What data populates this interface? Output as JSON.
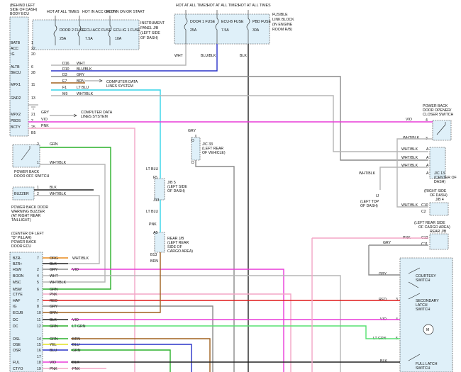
{
  "colors": {
    "WHT": "#b5b5b5",
    "BLU_BLK": "#2a33c9",
    "GRY": "#8a8a8a",
    "BRN": "#a0601e",
    "LT_BLU": "#34d3e8",
    "VIO": "#e83cd8",
    "PNK": "#f3a6c6",
    "GRN": "#2ab02a",
    "ORG": "#e88a1c",
    "YEL": "#e0e020",
    "BLK": "#222222",
    "RED": "#e01a1a",
    "LT_GRN": "#56e070",
    "BOX": "#dff0f9"
  },
  "body_ecu": {
    "header": [
      "(BEHIND LEFT",
      "SIDE OF DASH)",
      "BODY ECU"
    ],
    "pins": [
      "BATB",
      "ACC",
      "IG",
      "ALTB",
      "BECU",
      "MPX1",
      "GND2",
      "MPX2",
      "PBDS",
      "BCTY"
    ],
    "pin_numbers": [
      "1",
      "22",
      "20",
      "6",
      "28",
      "11",
      "13",
      "21",
      "2",
      "25"
    ]
  },
  "ip_jb": {
    "header": [
      "HOT AT ALL TIMES",
      "HOT IN ACC OR ON",
      "HOT IN ON OR START"
    ],
    "fuses": [
      {
        "name": "DOOR 2 FUSE",
        "amps": "25A"
      },
      {
        "name": "ECU-ACC FUSE",
        "amps": "7.5A"
      },
      {
        "name": "ECU-IG 1 FUSE",
        "amps": "10A"
      }
    ],
    "label": [
      "INSTRUMENT",
      "PANEL J/B",
      "(LEFT SIDE",
      "OF DASH)"
    ]
  },
  "fusible_block": {
    "header": [
      "HOT AT ALL TIMES",
      "HOT AT ALL TIMES",
      "HOT AT ALL TIMES"
    ],
    "fuses": [
      {
        "name": "DOOR 1 FUSE",
        "amps": "25A"
      },
      {
        "name": "ECU-B FUSE",
        "amps": "7.5A"
      },
      {
        "name": "PBD FUSE",
        "amps": "30A"
      }
    ],
    "label": [
      "FUSIBLE",
      "LINK BLOCK",
      "(IN ENGINE",
      "ROOM R/B)"
    ],
    "wires": [
      "WHT",
      "BLU/BLK",
      "BLK"
    ]
  },
  "connector_rows": [
    {
      "pin": "D16",
      "wire": "WHT"
    },
    {
      "pin": "D10",
      "wire": "BLU/BLK"
    },
    {
      "pin": "D3",
      "wire": "GRY"
    },
    {
      "pin": "E7",
      "wire": "BRN"
    },
    {
      "pin": "F1",
      "wire": "LT BLU"
    },
    {
      "pin": "M9",
      "wire": "WHT/BLK"
    }
  ],
  "computer_data_1": [
    "COMPUTER DATA",
    "LINES SYSTEM"
  ],
  "computer_data_2": [
    "COMPUTER DATA",
    "LINES SYSTEM"
  ],
  "mpx2_wire": "GRY",
  "pbds_wire": "VIO",
  "bcty_wire": "PNK",
  "bcty_pin": "B5",
  "jc33": [
    "J/C 33",
    "(LEFT REAR",
    "OF VEHICLE)"
  ],
  "jc33_wire": "GRY",
  "jc33_pins": [
    "D",
    "D"
  ],
  "jb5": [
    "J/B 5",
    "(LEFT SIDE",
    "OF DASH)"
  ],
  "jb5_pins": [
    "F5",
    "J13"
  ],
  "lt_blu_1": "LT BLU",
  "lt_blu_2": "LT BLU",
  "pnk_1": "PNK",
  "brn_1": "BRN",
  "rear_jb": [
    "REAR J/B",
    "(LEFT REAR",
    "SIDE OF",
    "CARGO AREA)"
  ],
  "rear_jb_pins": [
    "A5",
    "B13"
  ],
  "pbd_off_switch": {
    "pins": [
      "2",
      "1"
    ],
    "wires": [
      "GRN",
      "WHT/BLK"
    ],
    "label": [
      "POWER BACK",
      "DOOR OFF SWITCH"
    ]
  },
  "buzzer": {
    "name": "BUZZER",
    "pins": [
      "1",
      "2"
    ],
    "wires": [
      "BLK",
      "WHT/BLK"
    ],
    "label": [
      "POWER BACK DOOR",
      "WARNING BUZZER",
      "(AT RIGHT REAR",
      "TAILLIGHT)"
    ]
  },
  "pbd_ecu": {
    "label": [
      "(CENTER OF LEFT",
      "\"D\" PILLAR)",
      "POWER BACK",
      "DOOR ECU"
    ],
    "rows": [
      {
        "pin_name": "BZR-",
        "num": "7",
        "wire": "ORG",
        "ext": "WHT/BLK"
      },
      {
        "pin_name": "BZR+",
        "num": "",
        "wire": "BLK",
        "ext": ""
      },
      {
        "pin_name": "HSW",
        "num": "2",
        "wire": "GRY",
        "ext": "VIO"
      },
      {
        "pin_name": "BOON",
        "num": "4",
        "wire": "WHT",
        "ext": ""
      },
      {
        "pin_name": "MSC",
        "num": "5",
        "wire": "WHT/BLK",
        "ext": ""
      },
      {
        "pin_name": "MSW",
        "num": "6",
        "wire": "GRN",
        "ext": ""
      },
      {
        "pin_name": "CTYE",
        "num": "",
        "wire": "PNK",
        "ext": ""
      },
      {
        "pin_name": "HAF",
        "num": "7",
        "wire": "RED",
        "ext": ""
      },
      {
        "pin_name": "IG",
        "num": "8",
        "wire": "GRY",
        "ext": ""
      },
      {
        "pin_name": "ECUB",
        "num": "10",
        "wire": "BRN",
        "ext": ""
      },
      {
        "pin_name": "DC",
        "num": "11",
        "wire": "BLK",
        "ext": "VIO"
      },
      {
        "pin_name": "DC",
        "num": "12",
        "wire": "GRN",
        "ext": "LT GRN"
      },
      {
        "pin_name": "",
        "num": "",
        "wire": "",
        "ext": ""
      },
      {
        "pin_name": "OSL",
        "num": "14",
        "wire": "GRN",
        "ext": "BRN"
      },
      {
        "pin_name": "OSE",
        "num": "15",
        "wire": "YEL",
        "ext": "BLU"
      },
      {
        "pin_name": "OSR",
        "num": "16",
        "wire": "BLU",
        "ext": "GRN"
      },
      {
        "pin_name": "",
        "num": "17",
        "wire": "",
        "ext": ""
      },
      {
        "pin_name": "FUL",
        "num": "18",
        "wire": "VIO",
        "ext": "BLK"
      },
      {
        "pin_name": "CTYO",
        "num": "19",
        "wire": "PNK",
        "ext": "PNK"
      }
    ]
  },
  "closer_switch": {
    "label": [
      "POWER BACK",
      "DOOR OPENER/",
      "CLOSER SWITCH"
    ],
    "pins": [
      "4",
      "3"
    ],
    "wires": [
      "VIO",
      "WHT/BLK"
    ]
  },
  "jc13": {
    "label": [
      "J/C 13",
      "(CENTER OF",
      "DASH)"
    ],
    "pins": [
      "A",
      "A",
      "A",
      "A"
    ],
    "wires": [
      "WHT/BLK",
      "WHT/BLK",
      "WHT/BLK"
    ]
  },
  "left_top_dash": {
    "pin": "IJ",
    "wire": "WHT/BLK",
    "label": [
      "(LEFT TOP",
      "OF DASH)"
    ]
  },
  "jb4": {
    "label": [
      "(RIGHT SIDE",
      "OF DASH)",
      "J/B 4"
    ],
    "pins": [
      "C10",
      "C2"
    ],
    "wire": "WHT/BLK"
  },
  "cargo_jb": {
    "label": [
      "(LEFT REAR SIDE",
      "OF CARGO AREA)",
      "REAR J/B"
    ],
    "pins": [
      "C12",
      "C11"
    ],
    "wires": [
      "PNK",
      "GRY"
    ]
  },
  "courtesy_switch": {
    "label": [
      "COURTESY",
      "SWITCH"
    ],
    "wire": "GRY"
  },
  "secondary_latch": {
    "label": [
      "SECONDARY",
      "LATCH",
      "SWITCH"
    ],
    "wire": "RED",
    "pin": "3"
  },
  "motor": {
    "wires": [
      "VIO",
      "LT GRN"
    ],
    "pins": [
      "4",
      "5"
    ]
  },
  "full_latch": {
    "label": [
      "FULL LATCH",
      "SWITCH"
    ],
    "wire": "BLK"
  }
}
